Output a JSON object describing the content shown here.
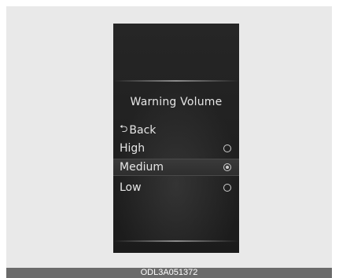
{
  "screen": {
    "title": "Warning Volume",
    "back_label": "Back",
    "back_icon": "return-arrow-icon",
    "options": [
      {
        "label": "High",
        "selected": false
      },
      {
        "label": "Medium",
        "selected": true
      },
      {
        "label": "Low",
        "selected": false
      }
    ]
  },
  "caption": "ODL3A051372",
  "colors": {
    "screen_bg": "#1f1f1f",
    "text": "#e6e6e6",
    "frame_bg": "#e9e9e9",
    "caption_bg": "#6b6b6b"
  }
}
